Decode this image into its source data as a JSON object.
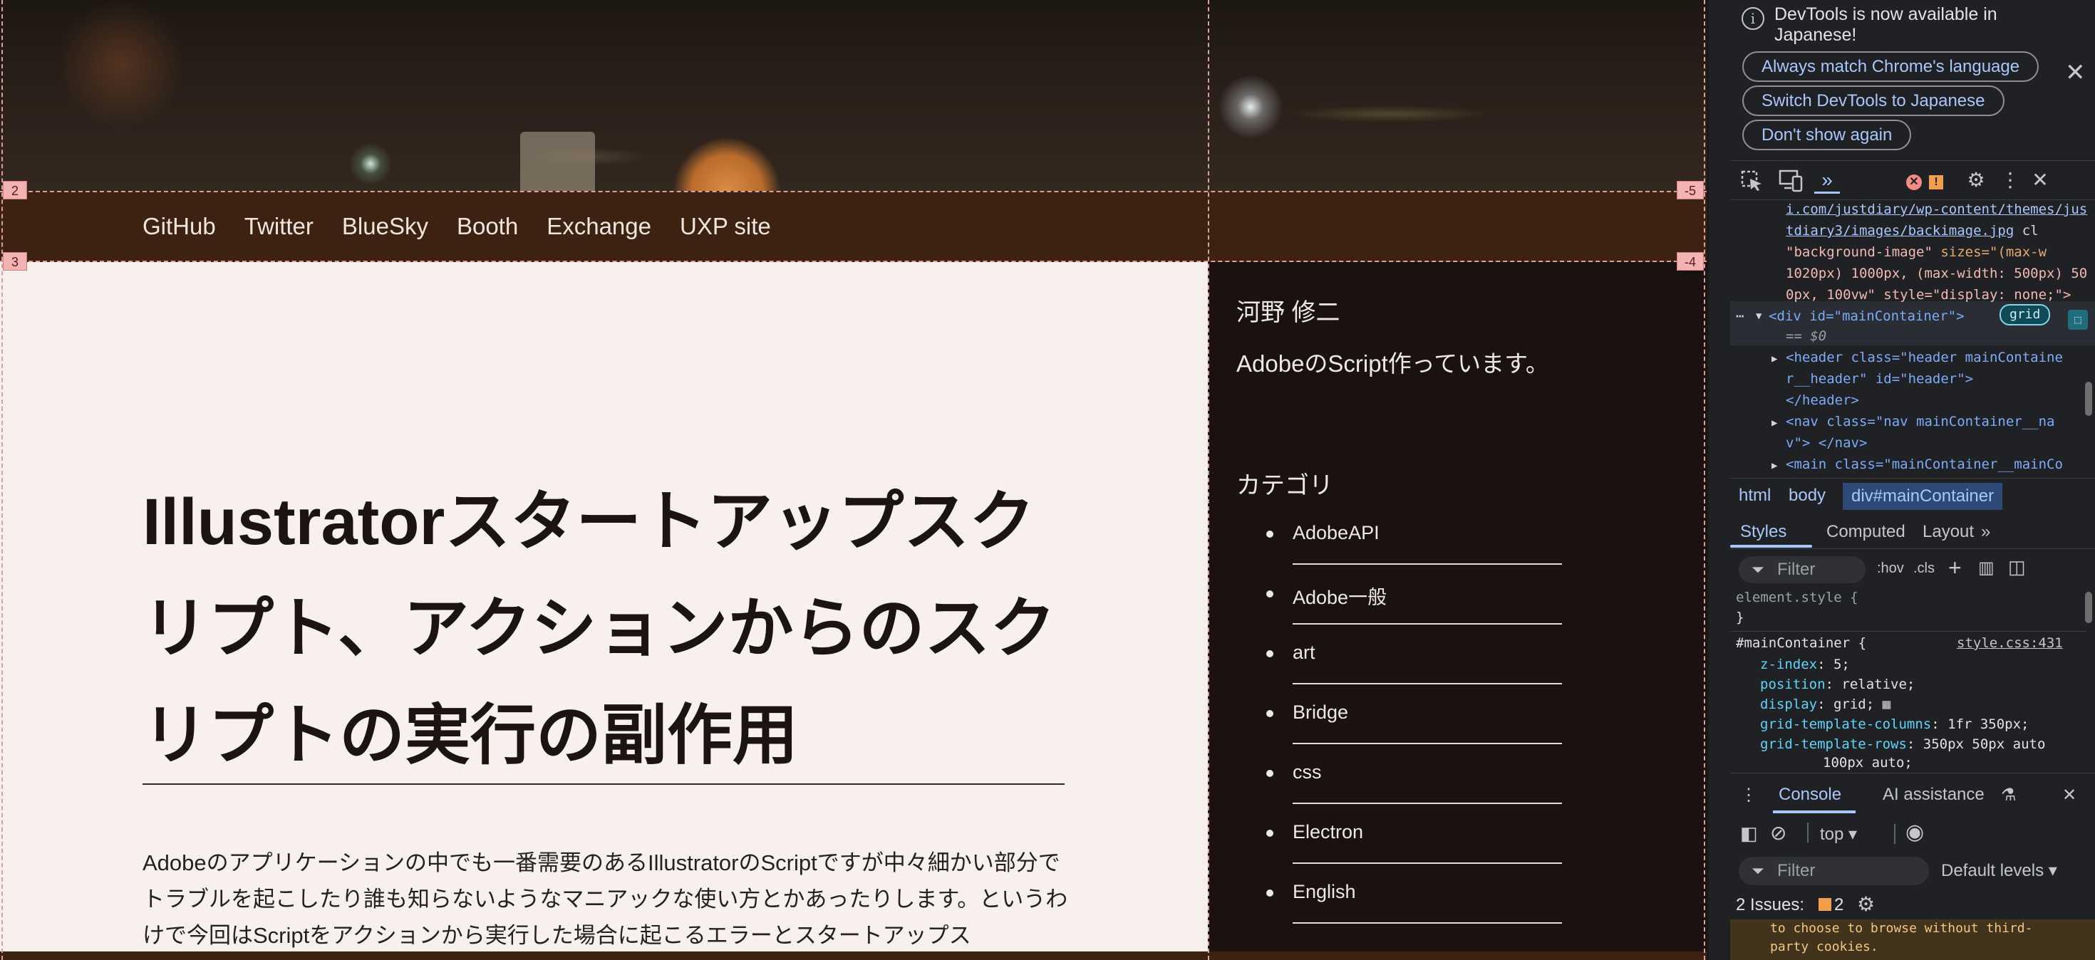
{
  "nav": {
    "links": [
      "GitHub",
      "Twitter",
      "BlueSky",
      "Booth",
      "Exchange",
      "UXP site"
    ]
  },
  "article": {
    "title": "Illustratorスタートアップスクリプト、アクションからのスクリプトの実行の副作用",
    "body": "Adobeのアプリケーションの中でも一番需要のあるIllustratorのScriptですが中々細かい部分でトラブルを起こしたり誰も知らないようなマニアックな使い方とかあったりします。というわけで今回はScriptをアクションから実行した場合に起こるエラーとスタートアップス"
  },
  "sidebar": {
    "author_name": "河野 修二",
    "author_desc": "AdobeのScript作っています。",
    "category_heading": "カテゴリ",
    "categories": [
      "AdobeAPI",
      "Adobe一般",
      "art",
      "Bridge",
      "css",
      "Electron",
      "English"
    ]
  },
  "grid_overlay": {
    "badges": [
      "2",
      "3",
      "-5",
      "-4"
    ]
  },
  "devtools": {
    "banner": {
      "text": "DevTools is now available in Japanese!",
      "buttons": [
        "Always match Chrome's language",
        "Switch DevTools to Japanese",
        "Don't show again"
      ]
    },
    "elements": {
      "line1": "i.com/justdiary/wp-content/themes/jus",
      "line2": "tdiary3/images/backimage.jpg",
      "line2b": " cl",
      "line3a": "\"background-image\"",
      "line3b": " sizes=\"(max-w",
      "line4": "1020px) 1000px, (max-width: 500px) 50",
      "line5": "0px, 100vw\" style=\"display: none;\">",
      "selected_tag": "<div id=\"mainContainer\">",
      "grid_badge": "grid",
      "dollar": "== $0",
      "header1": "<header class=\"header mainContaine",
      "header2": "r__header\" id=\"header\">",
      "header3": "</header>",
      "nav1": "<nav class=\"nav mainContainer__na",
      "nav2": "v\"> </nav>",
      "main1": "<main class=\"mainContainer__mainCo"
    },
    "breadcrumb": [
      "html",
      "body",
      "div#mainContainer"
    ],
    "style_tabs": [
      "Styles",
      "Computed",
      "Layout"
    ],
    "styles_filter_placeholder": "Filter",
    "hov": ":hov",
    "cls": ".cls",
    "styles": {
      "element_style": "element.style {",
      "close": "}",
      "selector": "#mainContainer {",
      "source": "style.css:431",
      "props": [
        {
          "name": "z-index",
          "value": "5;"
        },
        {
          "name": "position",
          "value": "relative;"
        },
        {
          "name": "display",
          "value": "grid;"
        },
        {
          "name": "grid-template-columns",
          "value": "1fr 350px;"
        },
        {
          "name": "grid-template-rows",
          "value": "350px 50px auto"
        }
      ],
      "overflow_line": "100px auto;"
    },
    "console": {
      "tabs": [
        "Console",
        "AI assistance"
      ],
      "context": "top",
      "filter_placeholder": "Filter",
      "levels": "Default levels",
      "issues_label": "2 Issues:",
      "issues_count": "2",
      "message_lines": [
        "to choose to browse without third-",
        "party cookies."
      ]
    }
  }
}
